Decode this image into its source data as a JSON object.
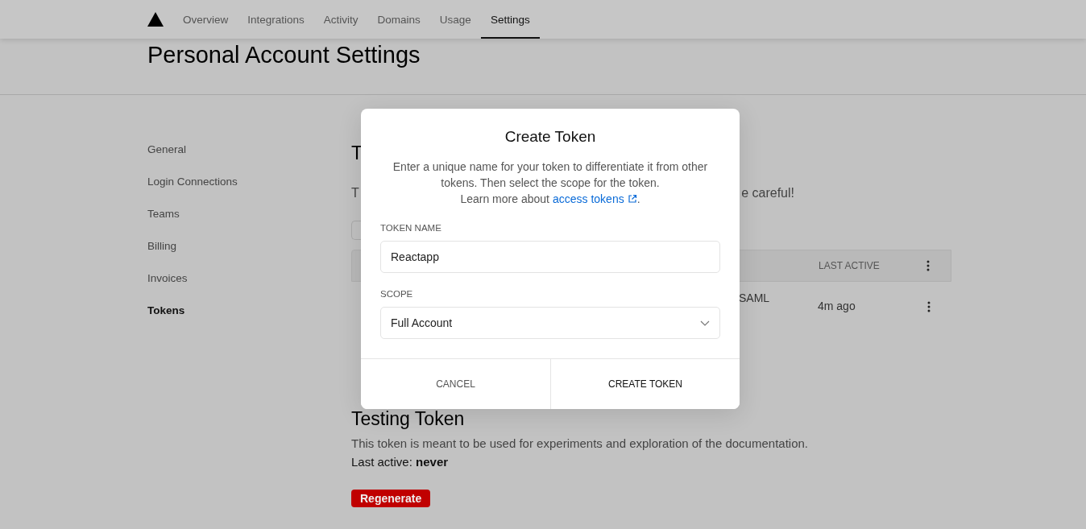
{
  "nav": {
    "items": [
      {
        "label": "Overview",
        "selected": false
      },
      {
        "label": "Integrations",
        "selected": false
      },
      {
        "label": "Activity",
        "selected": false
      },
      {
        "label": "Domains",
        "selected": false
      },
      {
        "label": "Usage",
        "selected": false
      },
      {
        "label": "Settings",
        "selected": true
      }
    ]
  },
  "page_title": "Personal Account Settings",
  "sidebar": {
    "items": [
      {
        "label": "General",
        "selected": false
      },
      {
        "label": "Login Connections",
        "selected": false
      },
      {
        "label": "Teams",
        "selected": false
      },
      {
        "label": "Billing",
        "selected": false
      },
      {
        "label": "Invoices",
        "selected": false
      },
      {
        "label": "Tokens",
        "selected": true
      }
    ]
  },
  "tokens_section": {
    "heading": "T",
    "intro_start": "T",
    "intro_end": "e careful!",
    "table": {
      "column_last": "LAST ACTIVE",
      "row": {
        "cell_3": "SAML",
        "last_active": "4m ago"
      }
    }
  },
  "testing_token": {
    "heading": "Testing Token",
    "description": "This token is meant to be used for experiments and exploration of the documentation.",
    "last_active_label": "Last active:",
    "last_active_value": "never",
    "button": "Regenerate"
  },
  "dialog": {
    "title": "Create Token",
    "description": "Enter a unique name for your token to differentiate it from other tokens. Then select the scope for the token.",
    "learn_more": "Learn more about",
    "link": "access tokens",
    "link_end": ".",
    "name_label": "TOKEN NAME",
    "name_value": "Reactapp",
    "scope_label": "SCOPE",
    "scope_value": "Full Account",
    "cancel": "CANCEL",
    "confirm": "CREATE TOKEN"
  }
}
